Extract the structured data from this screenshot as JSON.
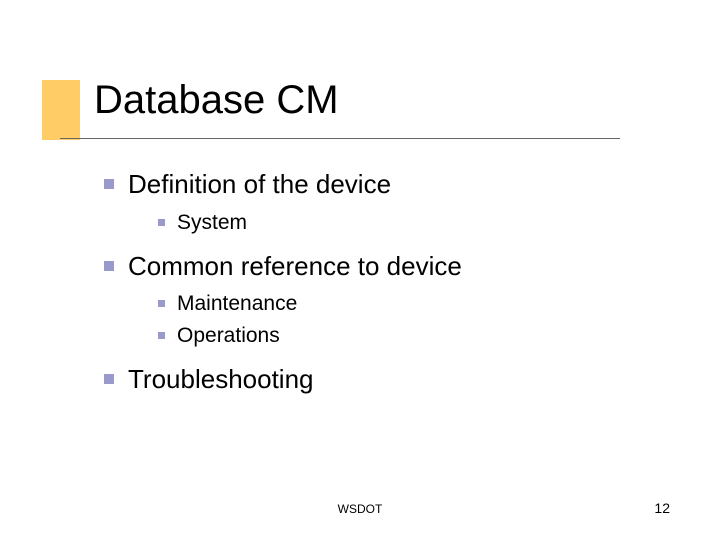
{
  "slide": {
    "title": "Database CM",
    "items": [
      {
        "text": "Definition of the device",
        "children": [
          {
            "text": "System"
          }
        ]
      },
      {
        "text": "Common reference to device",
        "children": [
          {
            "text": "Maintenance"
          },
          {
            "text": "Operations"
          }
        ]
      },
      {
        "text": "Troubleshooting",
        "children": []
      }
    ]
  },
  "footer": {
    "center": "WSDOT",
    "page": "12"
  }
}
